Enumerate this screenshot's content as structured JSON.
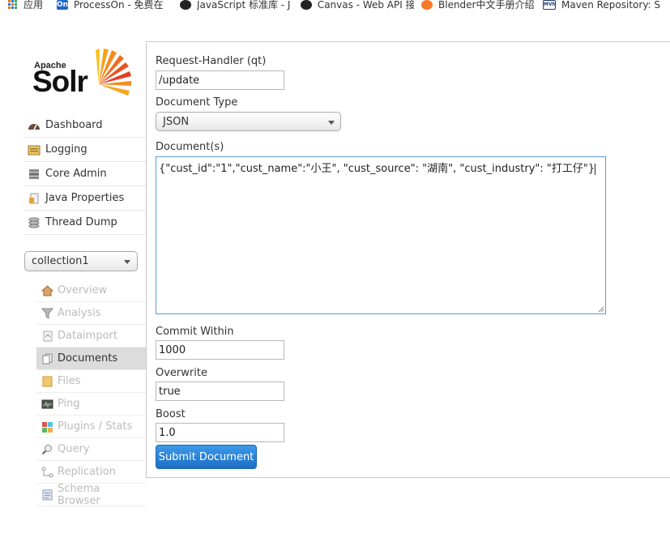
{
  "bookmarks": [
    {
      "label": "应用",
      "icon": "apps-grid-icon"
    },
    {
      "label": "ProcessOn - 免费在",
      "icon": "processon-icon"
    },
    {
      "label": "JavaScript 标准库 - J",
      "icon": "mdn-icon"
    },
    {
      "label": "Canvas - Web API 接",
      "icon": "mdn-icon"
    },
    {
      "label": "Blender中文手册介绍",
      "icon": "blender-icon"
    },
    {
      "label": "Maven Repository: S",
      "icon": "maven-icon"
    }
  ],
  "logo": {
    "apache": "Apache",
    "solr": "Solr"
  },
  "nav": {
    "items": [
      {
        "label": "Dashboard",
        "icon": "dashboard-icon"
      },
      {
        "label": "Logging",
        "icon": "logging-icon"
      },
      {
        "label": "Core Admin",
        "icon": "core-admin-icon"
      },
      {
        "label": "Java Properties",
        "icon": "java-properties-icon"
      },
      {
        "label": "Thread Dump",
        "icon": "thread-dump-icon"
      }
    ]
  },
  "core_selector": {
    "value": "collection1"
  },
  "core_menu": {
    "items": [
      {
        "label": "Overview",
        "icon": "overview-icon",
        "active": false
      },
      {
        "label": "Analysis",
        "icon": "analysis-icon",
        "active": false
      },
      {
        "label": "Dataimport",
        "icon": "dataimport-icon",
        "active": false
      },
      {
        "label": "Documents",
        "icon": "documents-icon",
        "active": true
      },
      {
        "label": "Files",
        "icon": "files-icon",
        "active": false
      },
      {
        "label": "Ping",
        "icon": "ping-icon",
        "active": false
      },
      {
        "label": "Plugins / Stats",
        "icon": "plugins-icon",
        "active": false
      },
      {
        "label": "Query",
        "icon": "query-icon",
        "active": false
      },
      {
        "label": "Replication",
        "icon": "replication-icon",
        "active": false
      },
      {
        "label": "Schema Browser",
        "icon": "schema-browser-icon",
        "active": false
      }
    ]
  },
  "form": {
    "request_handler_label": "Request-Handler (qt)",
    "request_handler_value": "/update",
    "document_type_label": "Document Type",
    "document_type_value": "JSON",
    "documents_label": "Document(s)",
    "documents_value": "{\"cust_id\":\"1\",\"cust_name\":\"小王\", \"cust_source\": \"湖南\", \"cust_industry\": \"打工仔\"}",
    "commit_within_label": "Commit Within",
    "commit_within_value": "1000",
    "overwrite_label": "Overwrite",
    "overwrite_value": "true",
    "boost_label": "Boost",
    "boost_value": "1.0",
    "submit_label": "Submit Document"
  },
  "colors": {
    "accent": "#1d6fc6",
    "textarea_focus": "#5f9bd6",
    "active_menu_bg": "#dcdcdc"
  }
}
